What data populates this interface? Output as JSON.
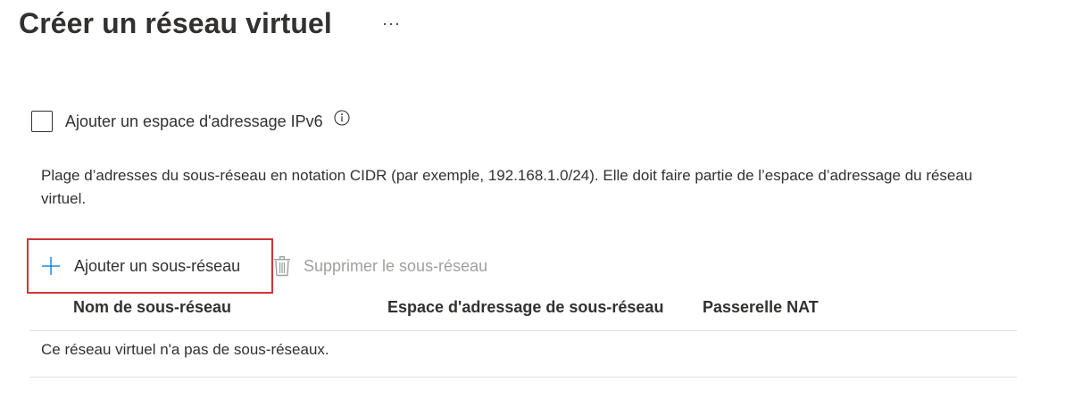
{
  "header": {
    "title": "Créer un réseau virtuel",
    "more_label": "···"
  },
  "ipv6": {
    "checkbox_label": "Ajouter un espace d'adressage IPv6",
    "checked": false,
    "info_icon": "info-icon"
  },
  "description": "Plage d’adresses du sous-réseau en notation CIDR (par exemple, 192.168.1.0/24). Elle doit faire partie de l’espace d’adressage du réseau virtuel.",
  "toolbar": {
    "add_label": "Ajouter un sous-réseau",
    "add_icon": "plus-icon",
    "delete_label": "Supprimer le sous-réseau",
    "delete_icon": "trash-icon",
    "highlight_color": "#d13438"
  },
  "table": {
    "columns": [
      "Nom de sous-réseau",
      "Espace d'adressage de sous-réseau",
      "Passerelle NAT"
    ],
    "empty_message": "Ce réseau virtuel n'a pas de sous-réseaux."
  },
  "colors": {
    "text": "#323130",
    "disabled_text": "#a19f9d",
    "accent": "#0078d4",
    "divider": "#e1dfdd"
  }
}
